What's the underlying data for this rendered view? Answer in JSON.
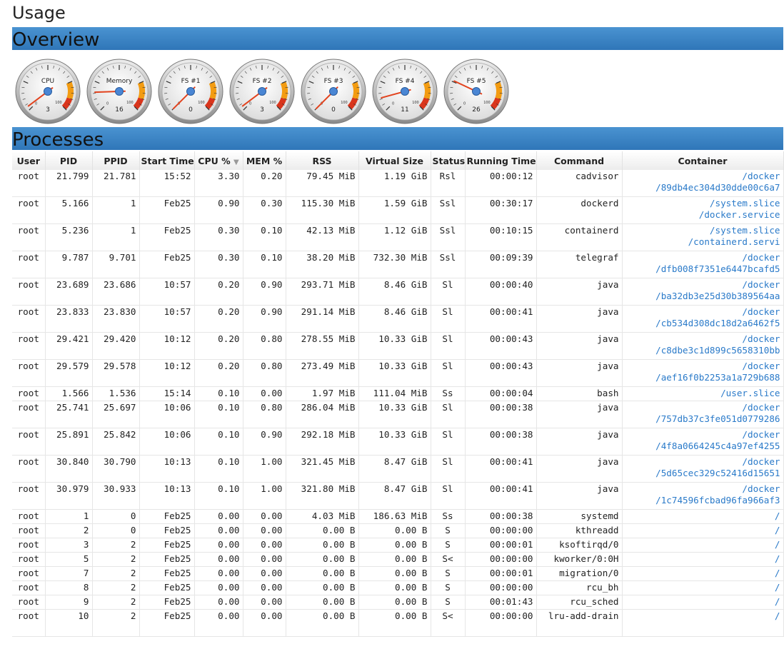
{
  "page": {
    "title": "Usage"
  },
  "sections": {
    "overview": "Overview",
    "processes": "Processes"
  },
  "gauges": [
    {
      "label": "CPU",
      "value": "3",
      "pct": 3
    },
    {
      "label": "Memory",
      "value": "16",
      "pct": 16
    },
    {
      "label": "FS #1",
      "value": "0",
      "pct": 0
    },
    {
      "label": "FS #2",
      "value": "3",
      "pct": 3
    },
    {
      "label": "FS #3",
      "value": "0",
      "pct": 0
    },
    {
      "label": "FS #4",
      "value": "11",
      "pct": 11
    },
    {
      "label": "FS #5",
      "value": "26",
      "pct": 26
    }
  ],
  "gauge_scale": {
    "min": "0",
    "max": "100"
  },
  "colors": {
    "header": "#3a85c6",
    "link": "#2a7ac9",
    "needle": "#e2431e",
    "warn": "#f39c12",
    "danger": "#d9351c"
  },
  "table": {
    "headers": {
      "user": "User",
      "pid": "PID",
      "ppid": "PPID",
      "start": "Start Time",
      "cpu": "CPU %",
      "cpu_sort": "▼",
      "mem": "MEM %",
      "rss": "RSS",
      "vsize": "Virtual Size",
      "status": "Status",
      "running": "Running Time",
      "command": "Command",
      "container": "Container"
    },
    "rows": [
      {
        "user": "root",
        "pid": "21.799",
        "ppid": "21.781",
        "start": "15:52",
        "cpu": "3.30",
        "mem": "0.20",
        "rss": "79.45 MiB",
        "vsize": "1.19 GiB",
        "status": "Rsl",
        "running": "00:00:12",
        "command": "cadvisor",
        "container": [
          "/docker",
          "/89db4ec304d30dde00c6a7"
        ]
      },
      {
        "user": "root",
        "pid": "5.166",
        "ppid": "1",
        "start": "Feb25",
        "cpu": "0.90",
        "mem": "0.30",
        "rss": "115.30 MiB",
        "vsize": "1.59 GiB",
        "status": "Ssl",
        "running": "00:30:17",
        "command": "dockerd",
        "container": [
          "/system.slice",
          "/docker.service"
        ]
      },
      {
        "user": "root",
        "pid": "5.236",
        "ppid": "1",
        "start": "Feb25",
        "cpu": "0.30",
        "mem": "0.10",
        "rss": "42.13 MiB",
        "vsize": "1.12 GiB",
        "status": "Ssl",
        "running": "00:10:15",
        "command": "containerd",
        "container": [
          "/system.slice",
          "/containerd.servi"
        ]
      },
      {
        "user": "root",
        "pid": "9.787",
        "ppid": "9.701",
        "start": "Feb25",
        "cpu": "0.30",
        "mem": "0.10",
        "rss": "38.20 MiB",
        "vsize": "732.30 MiB",
        "status": "Ssl",
        "running": "00:09:39",
        "command": "telegraf",
        "container": [
          "/docker",
          "/dfb008f7351e6447bcafd5"
        ]
      },
      {
        "user": "root",
        "pid": "23.689",
        "ppid": "23.686",
        "start": "10:57",
        "cpu": "0.20",
        "mem": "0.90",
        "rss": "293.71 MiB",
        "vsize": "8.46 GiB",
        "status": "Sl",
        "running": "00:00:40",
        "command": "java",
        "container": [
          "/docker",
          "/ba32db3e25d30b389564aa"
        ]
      },
      {
        "user": "root",
        "pid": "23.833",
        "ppid": "23.830",
        "start": "10:57",
        "cpu": "0.20",
        "mem": "0.90",
        "rss": "291.14 MiB",
        "vsize": "8.46 GiB",
        "status": "Sl",
        "running": "00:00:41",
        "command": "java",
        "container": [
          "/docker",
          "/cb534d308dc18d2a6462f5"
        ]
      },
      {
        "user": "root",
        "pid": "29.421",
        "ppid": "29.420",
        "start": "10:12",
        "cpu": "0.20",
        "mem": "0.80",
        "rss": "278.55 MiB",
        "vsize": "10.33 GiB",
        "status": "Sl",
        "running": "00:00:43",
        "command": "java",
        "container": [
          "/docker",
          "/c8dbe3c1d899c5658310bb"
        ]
      },
      {
        "user": "root",
        "pid": "29.579",
        "ppid": "29.578",
        "start": "10:12",
        "cpu": "0.20",
        "mem": "0.80",
        "rss": "273.49 MiB",
        "vsize": "10.33 GiB",
        "status": "Sl",
        "running": "00:00:43",
        "command": "java",
        "container": [
          "/docker",
          "/aef16f0b2253a1a729b688"
        ]
      },
      {
        "user": "root",
        "pid": "1.566",
        "ppid": "1.536",
        "start": "15:14",
        "cpu": "0.10",
        "mem": "0.00",
        "rss": "1.97 MiB",
        "vsize": "111.04 MiB",
        "status": "Ss",
        "running": "00:00:04",
        "command": "bash",
        "container": [
          "/user.slice"
        ]
      },
      {
        "user": "root",
        "pid": "25.741",
        "ppid": "25.697",
        "start": "10:06",
        "cpu": "0.10",
        "mem": "0.80",
        "rss": "286.04 MiB",
        "vsize": "10.33 GiB",
        "status": "Sl",
        "running": "00:00:38",
        "command": "java",
        "container": [
          "/docker",
          "/757db37c3fe051d0779286"
        ]
      },
      {
        "user": "root",
        "pid": "25.891",
        "ppid": "25.842",
        "start": "10:06",
        "cpu": "0.10",
        "mem": "0.90",
        "rss": "292.18 MiB",
        "vsize": "10.33 GiB",
        "status": "Sl",
        "running": "00:00:38",
        "command": "java",
        "container": [
          "/docker",
          "/4f8a0664245c4a97ef4255"
        ]
      },
      {
        "user": "root",
        "pid": "30.840",
        "ppid": "30.790",
        "start": "10:13",
        "cpu": "0.10",
        "mem": "1.00",
        "rss": "321.45 MiB",
        "vsize": "8.47 GiB",
        "status": "Sl",
        "running": "00:00:41",
        "command": "java",
        "container": [
          "/docker",
          "/5d65cec329c52416d15651"
        ]
      },
      {
        "user": "root",
        "pid": "30.979",
        "ppid": "30.933",
        "start": "10:13",
        "cpu": "0.10",
        "mem": "1.00",
        "rss": "321.80 MiB",
        "vsize": "8.47 GiB",
        "status": "Sl",
        "running": "00:00:41",
        "command": "java",
        "container": [
          "/docker",
          "/1c74596fcbad96fa966af3"
        ]
      },
      {
        "user": "root",
        "pid": "1",
        "ppid": "0",
        "start": "Feb25",
        "cpu": "0.00",
        "mem": "0.00",
        "rss": "4.03 MiB",
        "vsize": "186.63 MiB",
        "status": "Ss",
        "running": "00:00:38",
        "command": "systemd",
        "container": [
          "/"
        ]
      },
      {
        "user": "root",
        "pid": "2",
        "ppid": "0",
        "start": "Feb25",
        "cpu": "0.00",
        "mem": "0.00",
        "rss": "0.00 B",
        "vsize": "0.00 B",
        "status": "S",
        "running": "00:00:00",
        "command": "kthreadd",
        "container": [
          "/"
        ]
      },
      {
        "user": "root",
        "pid": "3",
        "ppid": "2",
        "start": "Feb25",
        "cpu": "0.00",
        "mem": "0.00",
        "rss": "0.00 B",
        "vsize": "0.00 B",
        "status": "S",
        "running": "00:00:01",
        "command": "ksoftirqd/0",
        "container": [
          "/"
        ]
      },
      {
        "user": "root",
        "pid": "5",
        "ppid": "2",
        "start": "Feb25",
        "cpu": "0.00",
        "mem": "0.00",
        "rss": "0.00 B",
        "vsize": "0.00 B",
        "status": "S<",
        "running": "00:00:00",
        "command": "kworker/0:0H",
        "container": [
          "/"
        ]
      },
      {
        "user": "root",
        "pid": "7",
        "ppid": "2",
        "start": "Feb25",
        "cpu": "0.00",
        "mem": "0.00",
        "rss": "0.00 B",
        "vsize": "0.00 B",
        "status": "S",
        "running": "00:00:01",
        "command": "migration/0",
        "container": [
          "/"
        ]
      },
      {
        "user": "root",
        "pid": "8",
        "ppid": "2",
        "start": "Feb25",
        "cpu": "0.00",
        "mem": "0.00",
        "rss": "0.00 B",
        "vsize": "0.00 B",
        "status": "S",
        "running": "00:00:00",
        "command": "rcu_bh",
        "container": [
          "/"
        ]
      },
      {
        "user": "root",
        "pid": "9",
        "ppid": "2",
        "start": "Feb25",
        "cpu": "0.00",
        "mem": "0.00",
        "rss": "0.00 B",
        "vsize": "0.00 B",
        "status": "S",
        "running": "00:01:43",
        "command": "rcu_sched",
        "container": [
          "/"
        ]
      },
      {
        "user": "root",
        "pid": "10",
        "ppid": "2",
        "start": "Feb25",
        "cpu": "0.00",
        "mem": "0.00",
        "rss": "0.00 B",
        "vsize": "0.00 B",
        "status": "S<",
        "running": "00:00:00",
        "command": "lru-add-drain",
        "container": [
          "/"
        ]
      }
    ]
  }
}
